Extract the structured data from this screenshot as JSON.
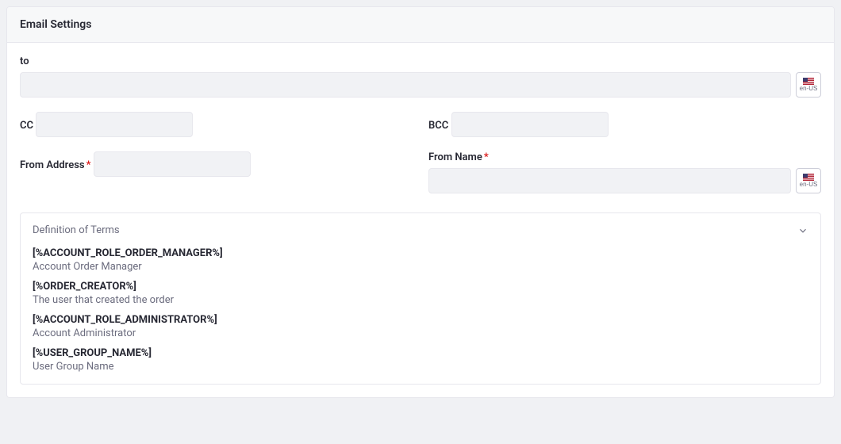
{
  "panel_title": "Email Settings",
  "fields": {
    "to": {
      "label": "to",
      "value": ""
    },
    "cc": {
      "label": "CC",
      "value": ""
    },
    "bcc": {
      "label": "BCC",
      "value": ""
    },
    "from_address": {
      "label": "From Address",
      "value": ""
    },
    "from_name": {
      "label": "From Name",
      "value": ""
    }
  },
  "locale": {
    "code": "en-US"
  },
  "terms": {
    "header": "Definition of Terms",
    "items": [
      {
        "token": "[%ACCOUNT_ROLE_ORDER_MANAGER%]",
        "desc": "Account Order Manager"
      },
      {
        "token": "[%ORDER_CREATOR%]",
        "desc": "The user that created the order"
      },
      {
        "token": "[%ACCOUNT_ROLE_ADMINISTRATOR%]",
        "desc": "Account Administrator"
      },
      {
        "token": "[%USER_GROUP_NAME%]",
        "desc": "User Group Name"
      }
    ]
  }
}
